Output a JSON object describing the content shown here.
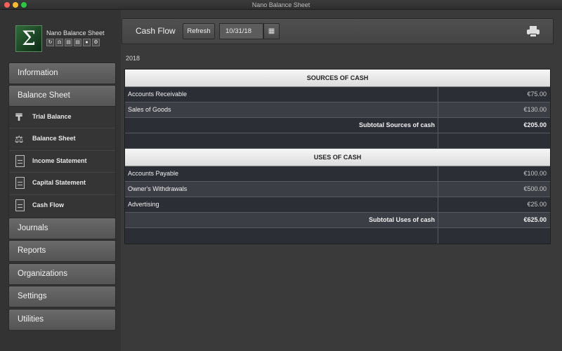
{
  "window": {
    "title": "Nano Balance Sheet"
  },
  "sidebar": {
    "app_name": "Nano Balance Sheet",
    "logo_symbol": "Σ",
    "mini_icons": [
      "refresh-icon",
      "balance-icon",
      "doc-icon",
      "doc-icon",
      "users-icon",
      "gears-icon"
    ],
    "nav": [
      {
        "label": "Information"
      },
      {
        "label": "Balance Sheet"
      },
      {
        "label": "Journals"
      },
      {
        "label": "Reports"
      },
      {
        "label": "Organizations"
      },
      {
        "label": "Settings"
      },
      {
        "label": "Utilities"
      }
    ],
    "sub_items": [
      {
        "label": "Trial Balance",
        "icon": "tenge-icon",
        "glyph": "₸"
      },
      {
        "label": "Balance Sheet",
        "icon": "scale-icon",
        "glyph": "⚖"
      },
      {
        "label": "Income Statement",
        "icon": "document-icon"
      },
      {
        "label": "Capital Statement",
        "icon": "document-icon"
      },
      {
        "label": "Cash Flow",
        "icon": "document-icon"
      }
    ]
  },
  "toolbar": {
    "title": "Cash Flow",
    "refresh_label": "Refresh",
    "date_value": "10/31/18",
    "calendar_glyph": "▦"
  },
  "report": {
    "year": "2018",
    "sources": {
      "header": "SOURCES OF CASH",
      "rows": [
        {
          "label": "Accounts Receivable",
          "amount": "€75.00"
        },
        {
          "label": "Sales of Goods",
          "amount": "€130.00"
        }
      ],
      "subtotal_label": "Subtotal Sources of cash",
      "subtotal_amount": "€205.00"
    },
    "uses": {
      "header": "USES OF CASH",
      "rows": [
        {
          "label": "Accounts Payable",
          "amount": "€100.00"
        },
        {
          "label": "Owner's Withdrawals",
          "amount": "€500.00"
        },
        {
          "label": "Advertising",
          "amount": "€25.00"
        }
      ],
      "subtotal_label": "Subtotal Uses of cash",
      "subtotal_amount": "€625.00"
    }
  }
}
